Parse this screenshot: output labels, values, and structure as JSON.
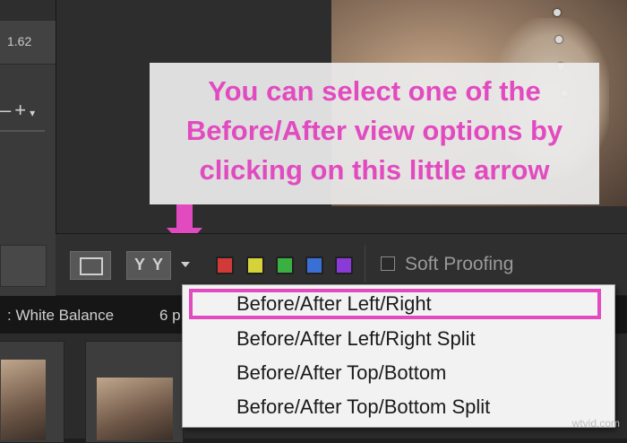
{
  "left_panel": {
    "readout": "1.62",
    "zoom_controls": "- +",
    "zoom_out_icon": "minus-icon",
    "zoom_in_icon": "plus-icon"
  },
  "callout": {
    "lines": [
      "You can select one of the",
      "Before/After view options by",
      "clicking on this little arrow"
    ],
    "color": "#e24bc0"
  },
  "toolbar": {
    "loupe_icon": "loupe-view-icon",
    "before_after_label": "Y Y",
    "dropdown_icon": "chevron-down-icon",
    "color_labels": [
      {
        "name": "red",
        "color": "#d23a3a"
      },
      {
        "name": "yellow",
        "color": "#d6d23a"
      },
      {
        "name": "green",
        "color": "#3ab043"
      },
      {
        "name": "blue",
        "color": "#3a6fd6"
      },
      {
        "name": "purple",
        "color": "#8a3ad6"
      }
    ],
    "soft_proofing_label": "Soft Proofing"
  },
  "filmstrip": {
    "info": ": White Balance",
    "count": "6 p"
  },
  "menu": {
    "items": [
      "Before/After Left/Right",
      "Before/After Left/Right Split",
      "Before/After Top/Bottom",
      "Before/After Top/Bottom Split"
    ],
    "highlighted_index": 0,
    "highlight_color": "#e24bc0"
  },
  "watermark": "wtvid.com"
}
